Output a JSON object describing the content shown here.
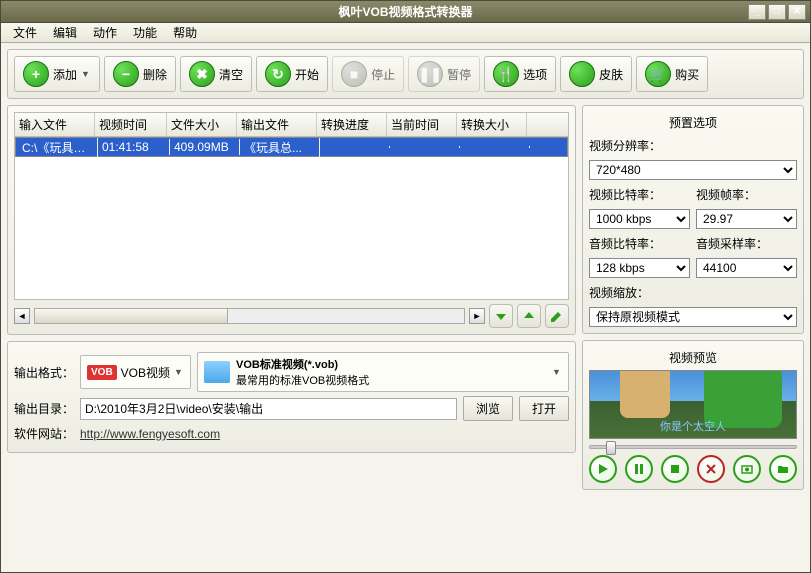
{
  "window": {
    "title": "枫叶VOB视频格式转换器"
  },
  "menu": [
    "文件",
    "编辑",
    "动作",
    "功能",
    "帮助"
  ],
  "toolbar": [
    {
      "icon": "+",
      "label": "添加",
      "dropdown": true,
      "enabled": true,
      "name": "add-button"
    },
    {
      "icon": "−",
      "label": "删除",
      "enabled": true,
      "name": "delete-button"
    },
    {
      "icon": "✖",
      "label": "清空",
      "enabled": true,
      "name": "clear-button"
    },
    {
      "icon": "↻",
      "label": "开始",
      "enabled": true,
      "name": "start-button"
    },
    {
      "icon": "■",
      "label": "停止",
      "enabled": false,
      "name": "stop-button"
    },
    {
      "icon": "❚❚",
      "label": "暂停",
      "enabled": false,
      "name": "pause-button"
    },
    {
      "icon": "🍴",
      "label": "选项",
      "enabled": true,
      "name": "options-button"
    },
    {
      "icon": "",
      "label": "皮肤",
      "enabled": true,
      "name": "skin-button"
    },
    {
      "icon": "🛒",
      "label": "购买",
      "enabled": true,
      "name": "buy-button"
    }
  ],
  "table": {
    "headers": [
      "输入文件",
      "视频时间",
      "文件大小",
      "输出文件",
      "转换进度",
      "当前时间",
      "转换大小"
    ],
    "rows": [
      {
        "cells": [
          "C:\\《玩具总...",
          "01:41:58",
          "409.09MB",
          "《玩具总...",
          "",
          "",
          ""
        ],
        "selected": true
      }
    ]
  },
  "output": {
    "format_label": "输出格式：",
    "format_value": "VOB视频",
    "desc_title": "VOB标准视频(*.vob)",
    "desc_sub": "最常用的标准VOB视频格式",
    "dir_label": "输出目录：",
    "dir_value": "D:\\2010年3月2日\\video\\安装\\输出",
    "browse": "浏览",
    "open": "打开",
    "site_label": "软件网站：",
    "site_url": "http://www.fengyesoft.com"
  },
  "presets": {
    "title": "预置选项",
    "resolution_label": "视频分辨率：",
    "resolution": "720*480",
    "vbitrate_label": "视频比特率：",
    "vbitrate": "1000 kbps",
    "fps_label": "视频帧率：",
    "fps": "29.97",
    "abitrate_label": "音频比特率：",
    "abitrate": "128 kbps",
    "asample_label": "音频采样率：",
    "asample": "44100",
    "scale_label": "视频缩放：",
    "scale": "保持原视频模式"
  },
  "preview": {
    "title": "视频预览",
    "subtitle": "你是个太空人"
  }
}
